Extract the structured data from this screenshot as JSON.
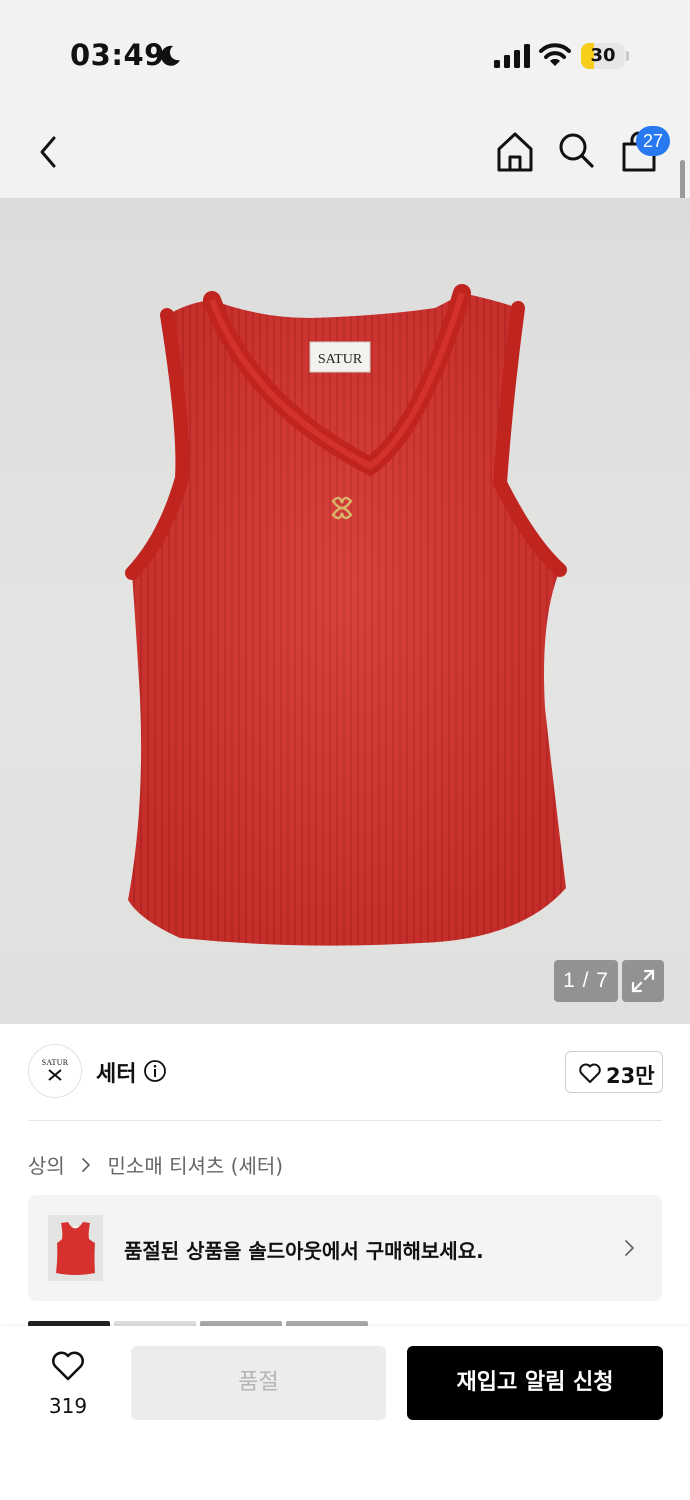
{
  "status_bar": {
    "time": "03:49",
    "battery_level": "30",
    "battery_fraction": 0.3,
    "icons": [
      "moon-icon",
      "signal-icon",
      "wifi-icon",
      "battery-icon"
    ]
  },
  "nav": {
    "icons": [
      "back-icon",
      "home-icon",
      "search-icon",
      "bag-icon"
    ],
    "cart_count": "27"
  },
  "gallery": {
    "page_indicator": "1 / 7",
    "product_label_text": "SATUR",
    "garment_color": "#d6312e",
    "icons": [
      "expand-icon"
    ]
  },
  "brand": {
    "logo_text": "SATUR",
    "name": "세터",
    "like_count": "23만",
    "icons": [
      "info-icon",
      "heart-outline-icon"
    ]
  },
  "breadcrumb": {
    "items": [
      "상의",
      "민소매 티셔츠 (세터)"
    ]
  },
  "soldout_banner": {
    "text": "품절된 상품을 솔드아웃에서 구매해보세요.",
    "icons": [
      "chevron-right-icon"
    ]
  },
  "color_tabs": {
    "colors": [
      "#222222",
      "#dcdcdc",
      "#a8a8a8",
      "#a8a8a8"
    ]
  },
  "bottom_bar": {
    "wish_count": "319",
    "soldout_label": "품절",
    "restock_label": "재입고 알림 신청",
    "icons": [
      "heart-icon"
    ]
  }
}
